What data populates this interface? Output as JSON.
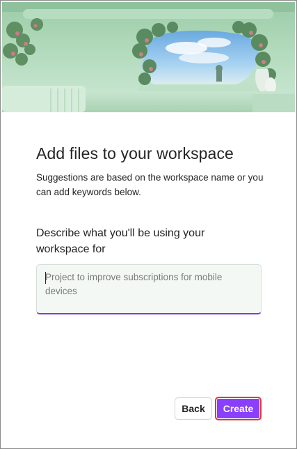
{
  "dialog": {
    "title": "Add files to your workspace",
    "subtitle": "Suggestions are based on the workspace name or you can add keywords below.",
    "field_label": "Describe what you'll be using your workspace for",
    "field": {
      "placeholder": "Project to improve subscriptions for mobile devices",
      "value": ""
    },
    "buttons": {
      "back_label": "Back",
      "create_label": "Create"
    }
  },
  "colors": {
    "accent": "#8a3ffc",
    "focus_outline": "#e03b3b",
    "hero_green": "#a9d3b4",
    "sky": "#8fc3ea"
  }
}
